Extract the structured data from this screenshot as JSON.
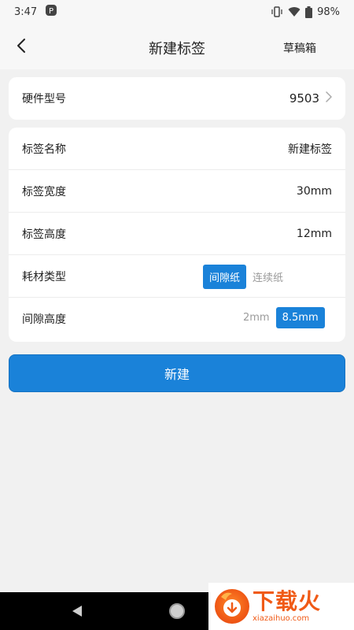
{
  "status_bar": {
    "time": "3:47",
    "battery": "98%"
  },
  "header": {
    "title": "新建标签",
    "drafts": "草稿箱"
  },
  "hardware": {
    "label": "硬件型号",
    "value": "9503"
  },
  "form": {
    "name_label": "标签名称",
    "name_value": "新建标签",
    "width_label": "标签宽度",
    "width_value": "30mm",
    "height_label": "标签高度",
    "height_value": "12mm",
    "material_label": "耗材类型",
    "material_options": [
      "间隙纸",
      "连续纸"
    ],
    "material_selected": "间隙纸",
    "gap_label": "间隙高度",
    "gap_options": [
      "2mm",
      "8.5mm"
    ],
    "gap_selected": "8.5mm"
  },
  "create_button": "新建",
  "watermark": {
    "title": "下载火",
    "url": "xiazaihuo.com"
  },
  "colors": {
    "accent": "#1a82d9",
    "background": "#f1f1f1",
    "card": "#ffffff"
  }
}
